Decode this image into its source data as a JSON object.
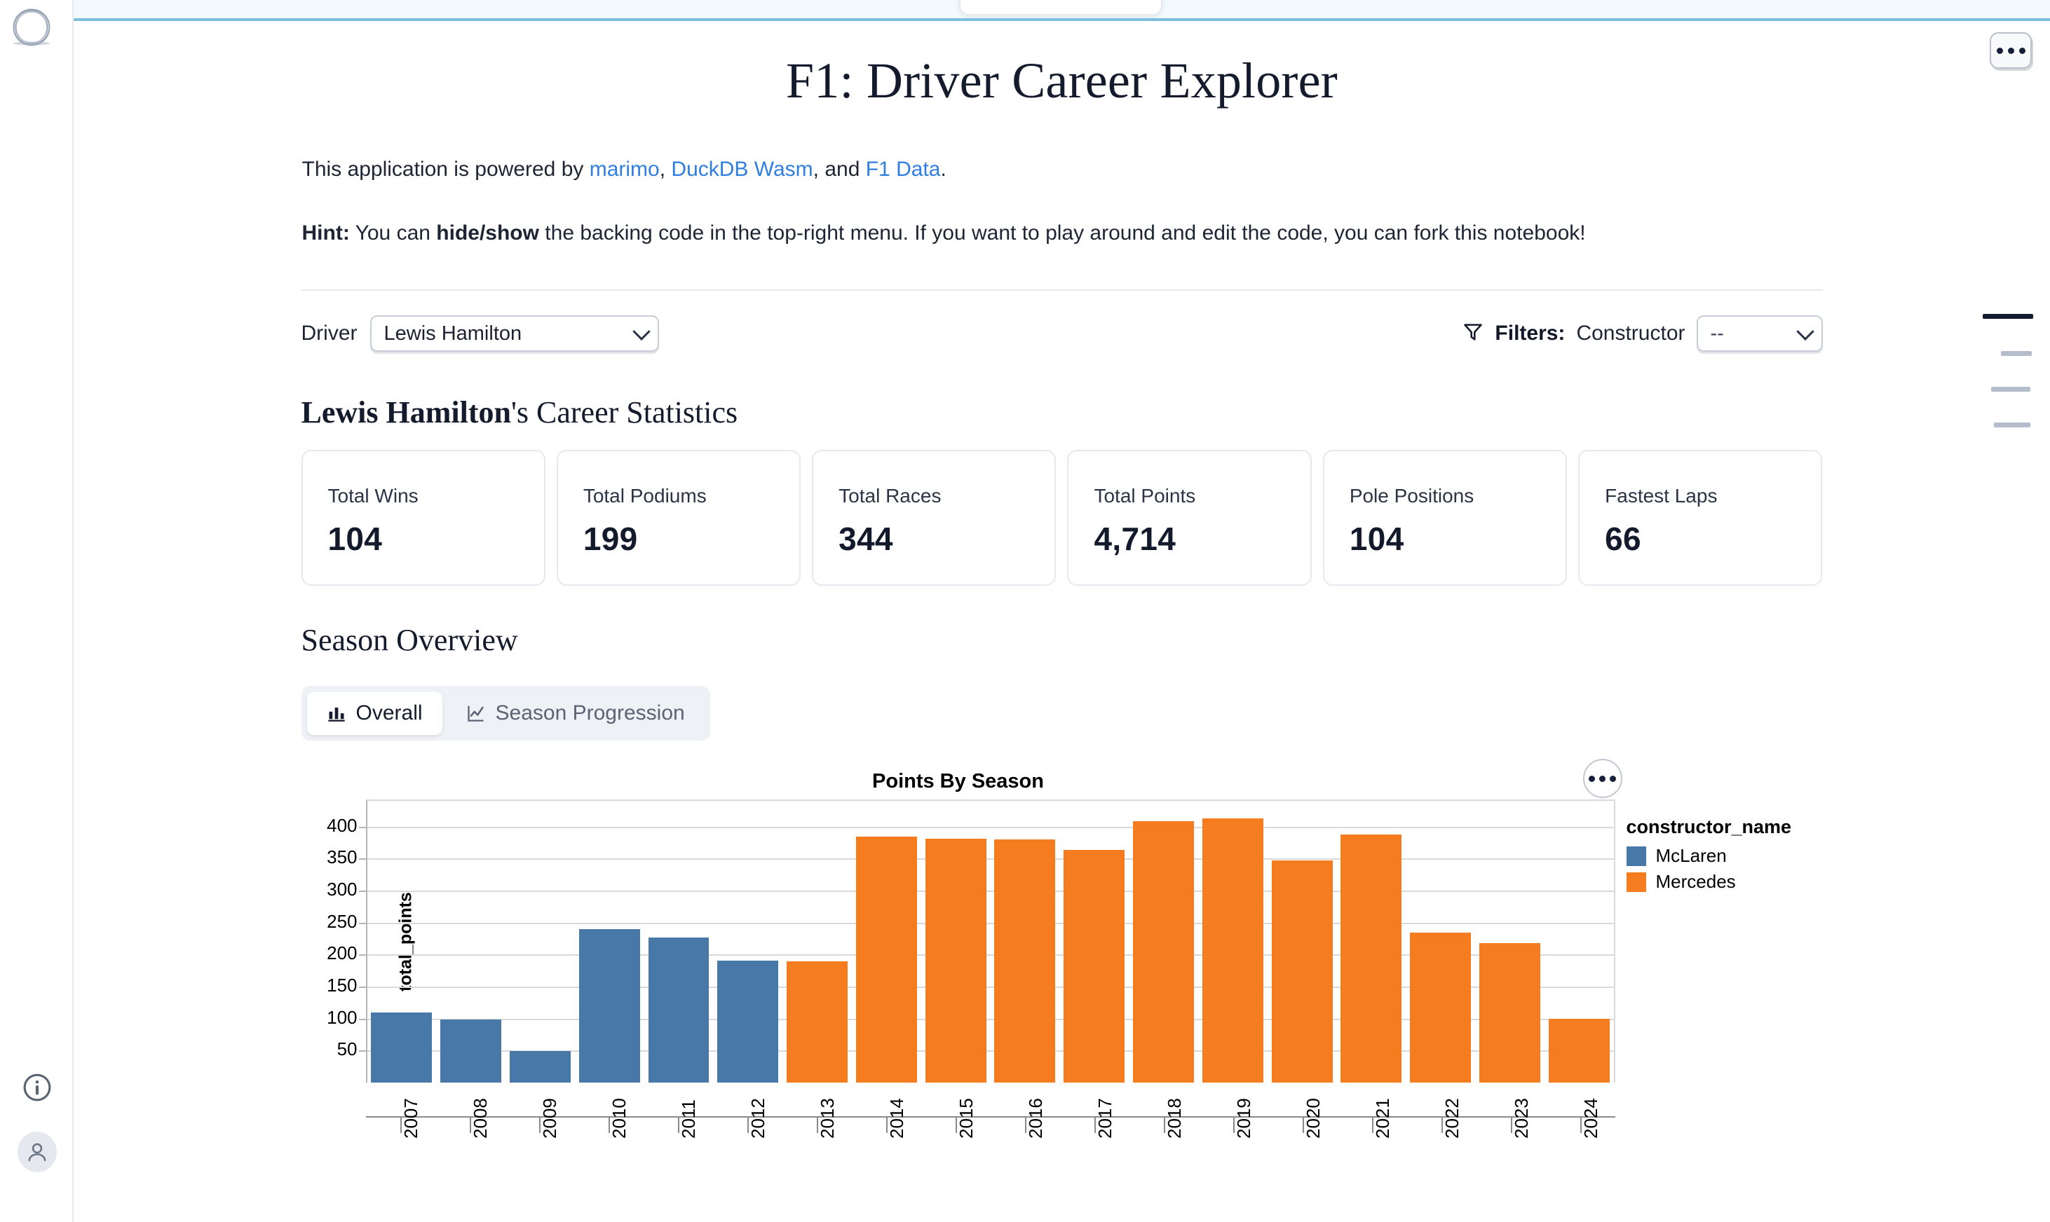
{
  "app": {
    "logo_icon": "marimo-circle-logo",
    "info_icon": "info-circle-icon",
    "avatar_icon": "user-avatar-icon",
    "notebook_menu_icon": "ellipsis-menu-icon",
    "minimap_icon": "outline-minimap"
  },
  "header": {
    "title": "F1: Driver Career Explorer"
  },
  "intro": {
    "lead_prefix": "This application is powered by ",
    "link_marimo": "marimo",
    "sep1": ", ",
    "link_duckdb": "DuckDB Wasm",
    "sep2": ", and ",
    "link_f1": "F1 Data",
    "lead_suffix": ".",
    "hint_label": "Hint:",
    "hint_part1": " You can ",
    "hint_bold": "hide/show",
    "hint_part2": " the backing code in the top-right menu. If you want to play around and edit the code, you can fork this notebook!"
  },
  "controls": {
    "driver_label": "Driver",
    "driver_value": "Lewis Hamilton",
    "filters_icon": "funnel-filter-icon",
    "filters_label": "Filters:",
    "constructor_label": "Constructor",
    "constructor_value": "--"
  },
  "stats": {
    "heading_name": "Lewis Hamilton",
    "heading_rest": "'s Career Statistics",
    "cards": [
      {
        "label": "Total Wins",
        "value": "104"
      },
      {
        "label": "Total Podiums",
        "value": "199"
      },
      {
        "label": "Total Races",
        "value": "344"
      },
      {
        "label": "Total Points",
        "value": "4,714"
      },
      {
        "label": "Pole Positions",
        "value": "104"
      },
      {
        "label": "Fastest Laps",
        "value": "66"
      }
    ]
  },
  "season": {
    "heading": "Season Overview",
    "tabs": [
      {
        "label": "Overall",
        "icon": "bar-chart-icon",
        "active": true
      },
      {
        "label": "Season Progression",
        "icon": "line-chart-icon",
        "active": false
      }
    ],
    "chart_menu_icon": "ellipsis-menu-icon"
  },
  "colors": {
    "mclaren": "#4878a8",
    "mercedes": "#f57c1f",
    "link": "#2f7ee0",
    "accent_bar": "#7cc0de"
  },
  "chart_data": {
    "type": "bar",
    "title": "Points By Season",
    "xlabel": "",
    "ylabel": "total_points",
    "legend_title": "constructor_name",
    "legend_position": "right",
    "grid": true,
    "ylim": [
      0,
      440
    ],
    "yticks": [
      50,
      100,
      150,
      200,
      250,
      300,
      350,
      400
    ],
    "categories": [
      "2007",
      "2008",
      "2009",
      "2010",
      "2011",
      "2012",
      "2013",
      "2014",
      "2015",
      "2016",
      "2017",
      "2018",
      "2019",
      "2020",
      "2021",
      "2022",
      "2023",
      "2024"
    ],
    "values": [
      109,
      98,
      49,
      240,
      227,
      190,
      189,
      384,
      381,
      380,
      363,
      408,
      413,
      347,
      387,
      234,
      218,
      100
    ],
    "point_colors": [
      "McLaren",
      "McLaren",
      "McLaren",
      "McLaren",
      "McLaren",
      "McLaren",
      "Mercedes",
      "Mercedes",
      "Mercedes",
      "Mercedes",
      "Mercedes",
      "Mercedes",
      "Mercedes",
      "Mercedes",
      "Mercedes",
      "Mercedes",
      "Mercedes",
      "Mercedes"
    ],
    "series": [
      {
        "name": "McLaren",
        "color": "#4878a8"
      },
      {
        "name": "Mercedes",
        "color": "#f57c1f"
      }
    ]
  }
}
